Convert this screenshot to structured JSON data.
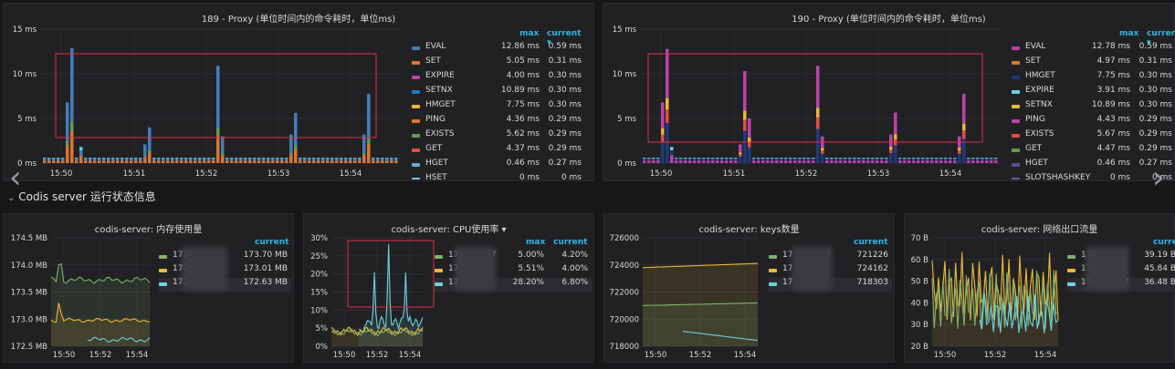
{
  "panel_189": {
    "title": "189 - Proxy (单位时间内的命令耗时，单位ms)",
    "legend_headers": {
      "max": "max",
      "current": "current ▾"
    },
    "legend": [
      {
        "name": "EVAL",
        "max": "12.86 ms",
        "current": "0.59 ms",
        "color": "#447ebc"
      },
      {
        "name": "SET",
        "max": "5.05 ms",
        "current": "0.31 ms",
        "color": "#e0752d"
      },
      {
        "name": "EXPIRE",
        "max": "4.00 ms",
        "current": "0.30 ms",
        "color": "#ba43a9"
      },
      {
        "name": "SETNX",
        "max": "10.89 ms",
        "current": "0.30 ms",
        "color": "#1f78c1"
      },
      {
        "name": "HMGET",
        "max": "7.75 ms",
        "current": "0.30 ms",
        "color": "#eab839"
      },
      {
        "name": "PING",
        "max": "4.36 ms",
        "current": "0.29 ms",
        "color": "#e0752d"
      },
      {
        "name": "EXISTS",
        "max": "5.62 ms",
        "current": "0.29 ms",
        "color": "#629e51"
      },
      {
        "name": "GET",
        "max": "4.37 ms",
        "current": "0.29 ms",
        "color": "#e24d42"
      },
      {
        "name": "HGET",
        "max": "0.46 ms",
        "current": "0.27 ms",
        "color": "#64b0c8"
      },
      {
        "name": "HSET",
        "max": "0 ms",
        "current": "0 ms",
        "color": "#6ed0e0"
      }
    ],
    "chart_data": {
      "type": "bar",
      "ylabel_ticks": [
        "15 ms",
        "10 ms",
        "5 ms",
        "0 ms"
      ],
      "ylim": [
        0,
        15
      ],
      "xticks": [
        "15:50",
        "15:51",
        "15:52",
        "15:53",
        "15:54"
      ],
      "stacked": true,
      "spikes": [
        {
          "time": "15:50",
          "total": 6.8
        },
        {
          "time": "15:50",
          "total": 12.86
        },
        {
          "time": "15:51",
          "total": 10.3
        },
        {
          "time": "15:52",
          "total": 10.89
        },
        {
          "time": "15:53",
          "total": 5.62
        },
        {
          "time": "15:54",
          "total": 7.75
        }
      ]
    }
  },
  "panel_190": {
    "title": "190 - Proxy (单位时间内的命令耗时，单位ms)",
    "legend_headers": {
      "max": "max",
      "current": "current ▾"
    },
    "legend": [
      {
        "name": "EVAL",
        "max": "12.78 ms",
        "current": "0.59 ms",
        "color": "#ba43a9"
      },
      {
        "name": "SET",
        "max": "4.97 ms",
        "current": "0.31 ms",
        "color": "#e0752d"
      },
      {
        "name": "HMGET",
        "max": "7.75 ms",
        "current": "0.30 ms",
        "color": "#1f3a7a"
      },
      {
        "name": "EXPIRE",
        "max": "3.91 ms",
        "current": "0.30 ms",
        "color": "#6ed0e0"
      },
      {
        "name": "SETNX",
        "max": "10.89 ms",
        "current": "0.30 ms",
        "color": "#eab839"
      },
      {
        "name": "PING",
        "max": "4.43 ms",
        "current": "0.29 ms",
        "color": "#ba43a9"
      },
      {
        "name": "EXISTS",
        "max": "5.67 ms",
        "current": "0.29 ms",
        "color": "#e24d42"
      },
      {
        "name": "GET",
        "max": "4.47 ms",
        "current": "0.29 ms",
        "color": "#629e51"
      },
      {
        "name": "HGET",
        "max": "0.46 ms",
        "current": "0.27 ms",
        "color": "#614d93"
      },
      {
        "name": "SLOTSHASHKEY",
        "max": "0 ms",
        "current": "0 ms",
        "color": "#705da0"
      }
    ],
    "chart_data": {
      "type": "bar",
      "ylabel_ticks": [
        "15 ms",
        "10 ms",
        "5 ms",
        "0 ms"
      ],
      "ylim": [
        0,
        15
      ],
      "xticks": [
        "15:50",
        "15:51",
        "15:52",
        "15:53",
        "15:54"
      ],
      "stacked": true
    }
  },
  "section": {
    "title": "Codis server 运行状态信息"
  },
  "mem": {
    "title": "codis-server:  内存使用量",
    "header_current": "current",
    "rows": [
      {
        "name": "172",
        "suffix": "6",
        "current": "173.70 MB",
        "color": "#7eb26d"
      },
      {
        "name": "172",
        "suffix": "",
        "current": "173.01 MB",
        "color": "#eab839"
      },
      {
        "name": "172",
        "suffix": "",
        "current": "172.63 MB",
        "color": "#6ed0e0"
      }
    ],
    "chart_data": {
      "type": "line",
      "yticks": [
        "174.5 MB",
        "174.0 MB",
        "173.5 MB",
        "173.0 MB",
        "172.5 MB"
      ],
      "ylim": [
        172.5,
        174.5
      ],
      "xticks": [
        "15:50",
        "15:52",
        "15:54"
      ],
      "series": [
        {
          "color": "#7eb26d",
          "level": 173.72
        },
        {
          "color": "#eab839",
          "level": 172.98
        },
        {
          "color": "#6ed0e0",
          "level": 172.62
        }
      ]
    }
  },
  "cpu": {
    "title": "codis-server:  CPU使用率 ▾",
    "header_max": "max",
    "header_current": "current",
    "rows": [
      {
        "name": "172",
        "suffix": "7",
        "max": "5.00%",
        "current": "4.20%",
        "color": "#7eb26d"
      },
      {
        "name": "172",
        "suffix": "",
        "max": "5.51%",
        "current": "4.00%",
        "color": "#eab839"
      },
      {
        "name": "172",
        "suffix": "",
        "max": "28.20%",
        "current": "6.80%",
        "color": "#6ed0e0"
      }
    ],
    "chart_data": {
      "type": "line",
      "yticks": [
        "30%",
        "25%",
        "20%",
        "15%",
        "10%",
        "5%",
        "0%"
      ],
      "ylim": [
        0,
        30
      ],
      "xticks": [
        "15:50",
        "15:52",
        "15:54"
      ],
      "peaks": [
        20.5,
        28.2,
        20.4
      ]
    }
  },
  "keys": {
    "title": "codis-server:  keys数量",
    "header_current": "current",
    "rows": [
      {
        "name": "17",
        "suffix": "7",
        "current": "721226",
        "color": "#7eb26d"
      },
      {
        "name": "17",
        "suffix": "",
        "current": "724162",
        "color": "#eab839"
      },
      {
        "name": "17",
        "suffix": "",
        "current": "718303",
        "color": "#6ed0e0"
      }
    ],
    "chart_data": {
      "type": "line",
      "yticks": [
        "726000",
        "724000",
        "722000",
        "720000",
        "718000"
      ],
      "ylim": [
        718000,
        726000
      ],
      "xticks": [
        "15:50",
        "15:52",
        "15:54"
      ],
      "series": [
        {
          "color": "#eab839",
          "level": 724000
        },
        {
          "color": "#7eb26d",
          "level": 721100
        },
        {
          "color": "#6ed0e0",
          "level": 718500
        }
      ]
    }
  },
  "net": {
    "title": "codis-server:  网络出口流量",
    "header_current": "current",
    "rows": [
      {
        "name": "172",
        "suffix": "",
        "current": "39.19 B",
        "color": "#7eb26d"
      },
      {
        "name": "172",
        "suffix": "",
        "current": "45.84 B",
        "color": "#eab839"
      },
      {
        "name": "172",
        "suffix": "7",
        "current": "36.48 B",
        "color": "#6ed0e0"
      }
    ],
    "chart_data": {
      "type": "line",
      "yticks": [
        "70 B",
        "60 B",
        "50 B",
        "40 B",
        "30 B",
        "20 B"
      ],
      "ylim": [
        20,
        70
      ],
      "xticks": [
        "15:50",
        "15:52",
        "15:54"
      ]
    }
  }
}
